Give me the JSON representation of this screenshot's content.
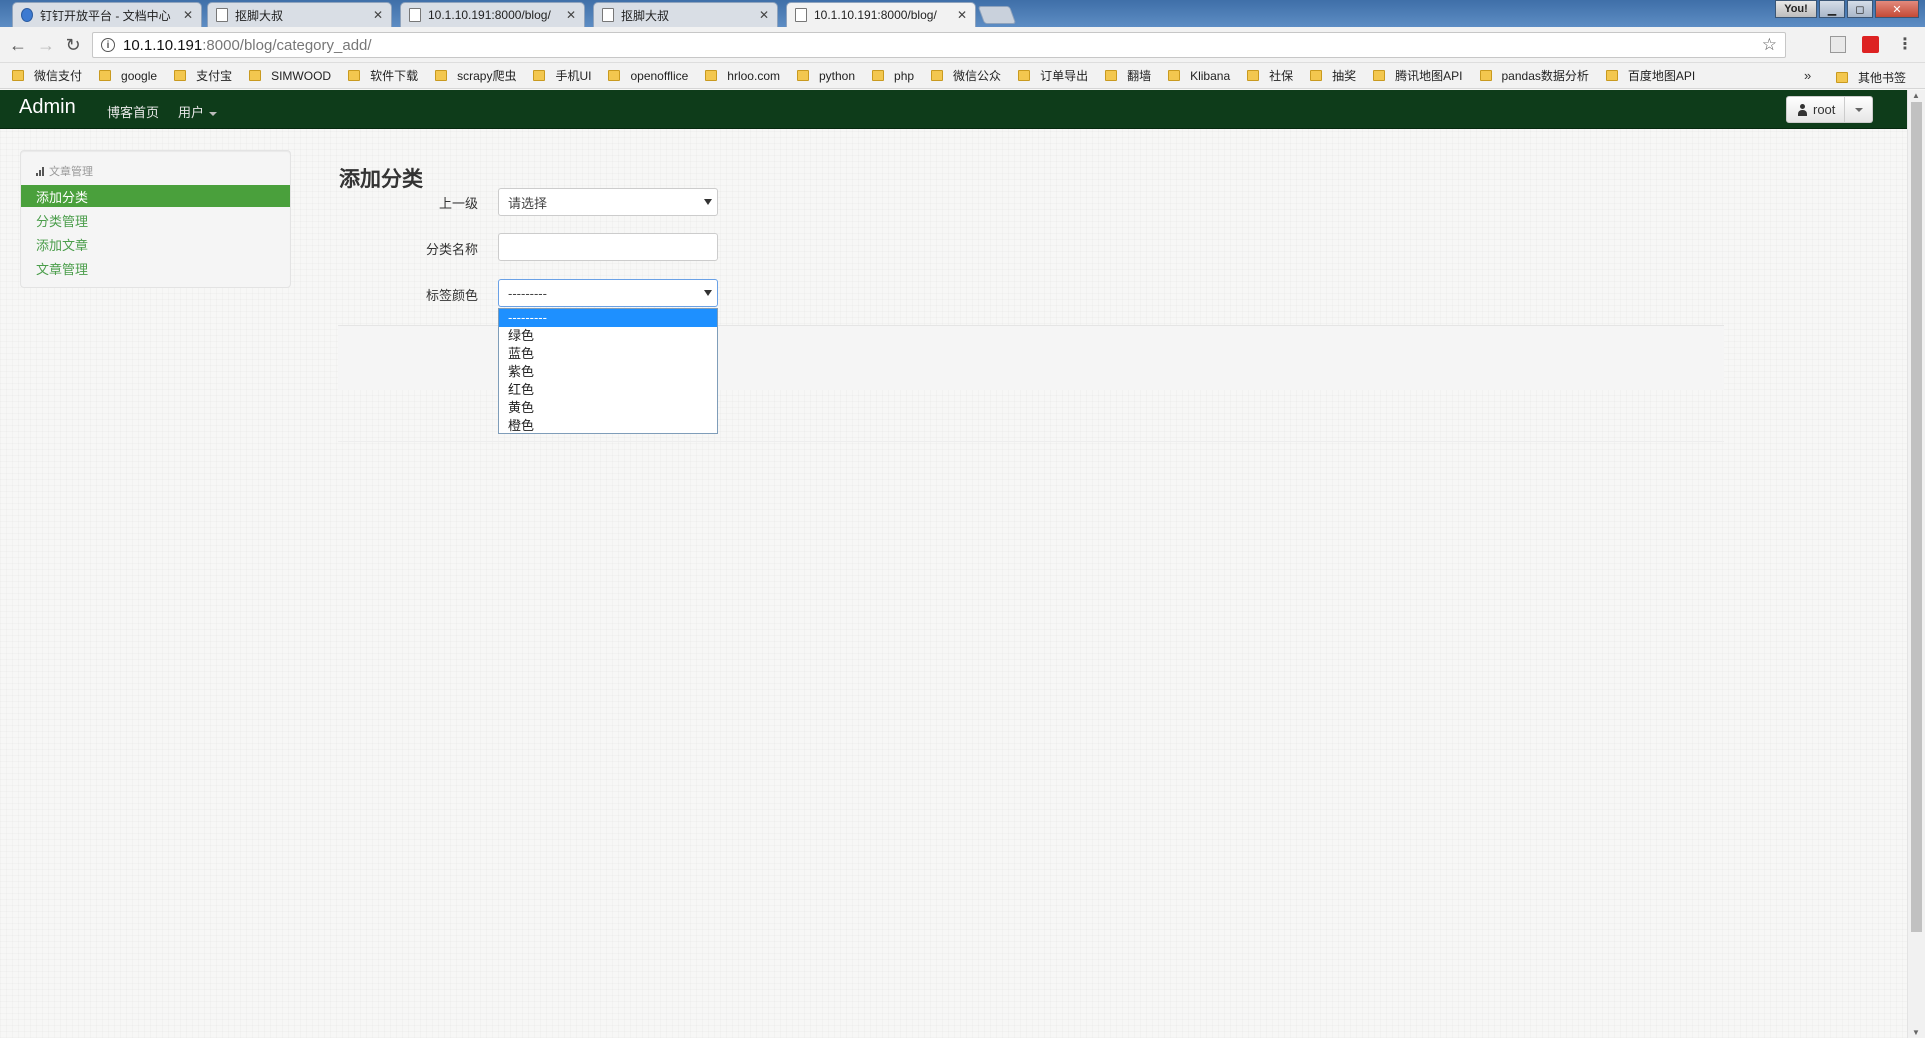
{
  "browser": {
    "tabs": [
      {
        "title": "钉钉开放平台 - 文档中心",
        "icon": "dingtalk-icon"
      },
      {
        "title": "抠脚大叔",
        "icon": "page-icon"
      },
      {
        "title": "10.1.10.191:8000/blog/",
        "icon": "page-icon"
      },
      {
        "title": "抠脚大叔",
        "icon": "page-icon"
      },
      {
        "title": "10.1.10.191:8000/blog/",
        "icon": "page-icon",
        "active": true
      }
    ],
    "window_user": "You!",
    "url_host": "10.1.10.191",
    "url_path": ":8000/blog/category_add/",
    "bookmarks": [
      "微信支付",
      "google",
      "支付宝",
      "SIMWOOD",
      "软件下载",
      "scrapy爬虫",
      "手机UI",
      "openofflice",
      "hrloo.com",
      "python",
      "php",
      "微信公众",
      "订单导出",
      "翻墙",
      "Klibana",
      "社保",
      "抽奖",
      "腾讯地图API",
      "pandas数据分析",
      "百度地图API"
    ],
    "bookmark_overflow": "»",
    "other_bookmarks": "其他书签"
  },
  "navbar": {
    "brand": "Admin",
    "links": [
      "博客首页",
      "用户"
    ],
    "user": "root"
  },
  "sidebar": {
    "header": "文章管理",
    "items": [
      "添加分类",
      "分类管理",
      "添加文章",
      "文章管理"
    ],
    "active_index": 0
  },
  "form": {
    "title": "添加分类",
    "parent_label": "上一级",
    "parent_value": "请选择",
    "name_label": "分类名称",
    "name_value": "",
    "color_label": "标签颜色",
    "color_value": "---------",
    "color_options": [
      "---------",
      "绿色",
      "蓝色",
      "紫色",
      "红色",
      "黄色",
      "橙色"
    ],
    "color_options_selected": 0
  },
  "colors": {
    "navbar_bg": "#0e3c1a",
    "sidebar_active": "#4aa03c",
    "link": "#4a9d4a",
    "option_highlight": "#1e90ff"
  }
}
